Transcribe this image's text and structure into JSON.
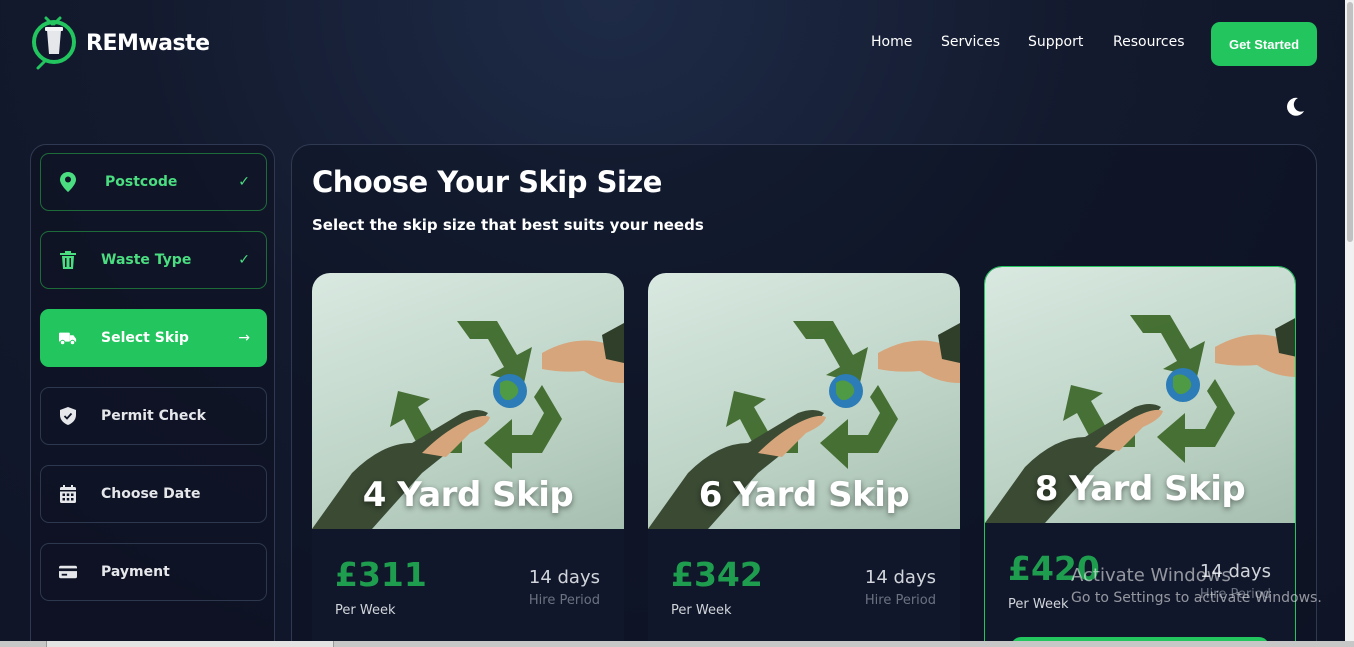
{
  "header": {
    "brand": "REMwaste",
    "logo_icon": "skip-bin-logo-icon",
    "nav": [
      {
        "label": "Home"
      },
      {
        "label": "Services"
      },
      {
        "label": "Support"
      },
      {
        "label": "Resources"
      }
    ],
    "cta_label": "Get Started",
    "theme_toggle_icon": "moon-icon"
  },
  "sidebar": {
    "steps": [
      {
        "label": "Postcode",
        "icon": "location-pin-icon",
        "state": "done",
        "trail": "✓"
      },
      {
        "label": "Waste Type",
        "icon": "trash-icon",
        "state": "done",
        "trail": "✓"
      },
      {
        "label": "Select Skip",
        "icon": "truck-icon",
        "state": "active",
        "trail": "→"
      },
      {
        "label": "Permit Check",
        "icon": "shield-icon",
        "state": "pending",
        "trail": ""
      },
      {
        "label": "Choose Date",
        "icon": "calendar-icon",
        "state": "pending",
        "trail": ""
      },
      {
        "label": "Payment",
        "icon": "credit-card-icon",
        "state": "pending",
        "trail": ""
      }
    ]
  },
  "main": {
    "title": "Choose Your Skip Size",
    "subtitle": "Select the skip size that best suits your needs",
    "cards": [
      {
        "name": "4 Yard Skip",
        "price": "£311",
        "per": "Per Week",
        "days": "14 days",
        "hire": "Hire Period",
        "selected": false
      },
      {
        "name": "6 Yard Skip",
        "price": "£342",
        "per": "Per Week",
        "days": "14 days",
        "hire": "Hire Period",
        "selected": false
      },
      {
        "name": "8 Yard Skip",
        "price": "£420",
        "per": "Per Week",
        "days": "14 days",
        "hire": "Hire Period",
        "selected": true
      }
    ]
  },
  "watermark": {
    "line1": "Activate Windows",
    "line2": "Go to Settings to activate Windows."
  },
  "colors": {
    "accent": "#22c55e",
    "price": "#1f9d4f",
    "background": "#131a2e"
  }
}
